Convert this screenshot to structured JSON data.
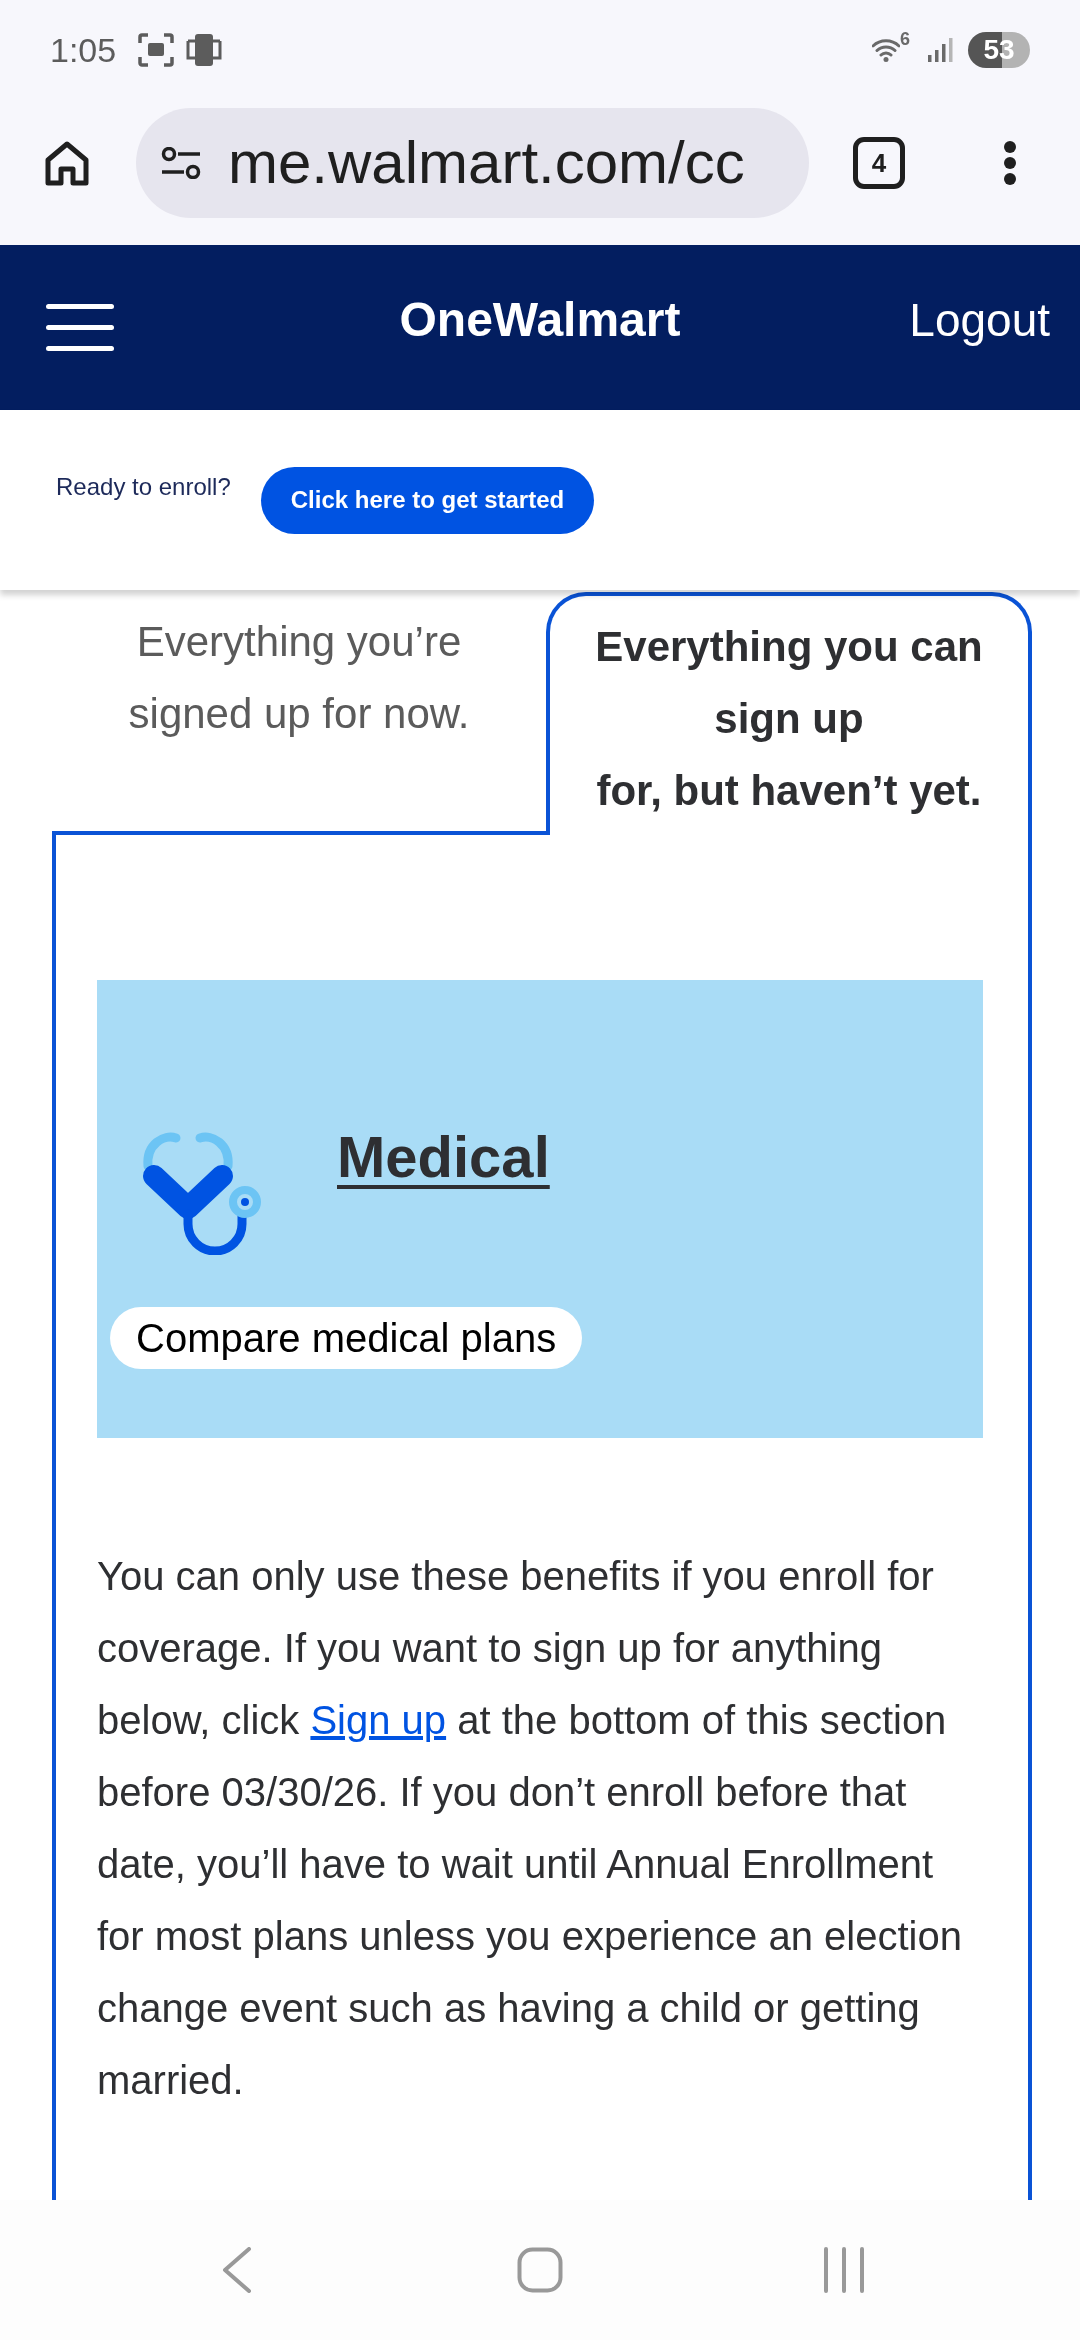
{
  "status_bar": {
    "time": "1:05",
    "wifi_label": "6",
    "battery": "53"
  },
  "browser": {
    "url": "me.walmart.com/cc",
    "tab_count": "4"
  },
  "header": {
    "title": "OneWalmart",
    "logout": "Logout"
  },
  "enroll_banner": {
    "prompt": "Ready to enroll?",
    "button": "Click here to get started"
  },
  "tabs": [
    {
      "label": "Everything you’re signed up for now.",
      "selected": false
    },
    {
      "label": "Everything you can sign up\nfor, but haven’t yet.",
      "selected": true
    }
  ],
  "benefit_card": {
    "title": "Medical",
    "action": "Compare medical plans"
  },
  "notice": {
    "before": "You can only use these benefits if you enroll for coverage. If you want to sign up for anything below, click ",
    "link": "Sign up",
    "after": " at the bottom of this section before 03/30/26. If you don’t enroll before that date, you’ll have to wait until Annual Enrollment for most plans unless you experience an election change event such as having a child or getting married."
  }
}
